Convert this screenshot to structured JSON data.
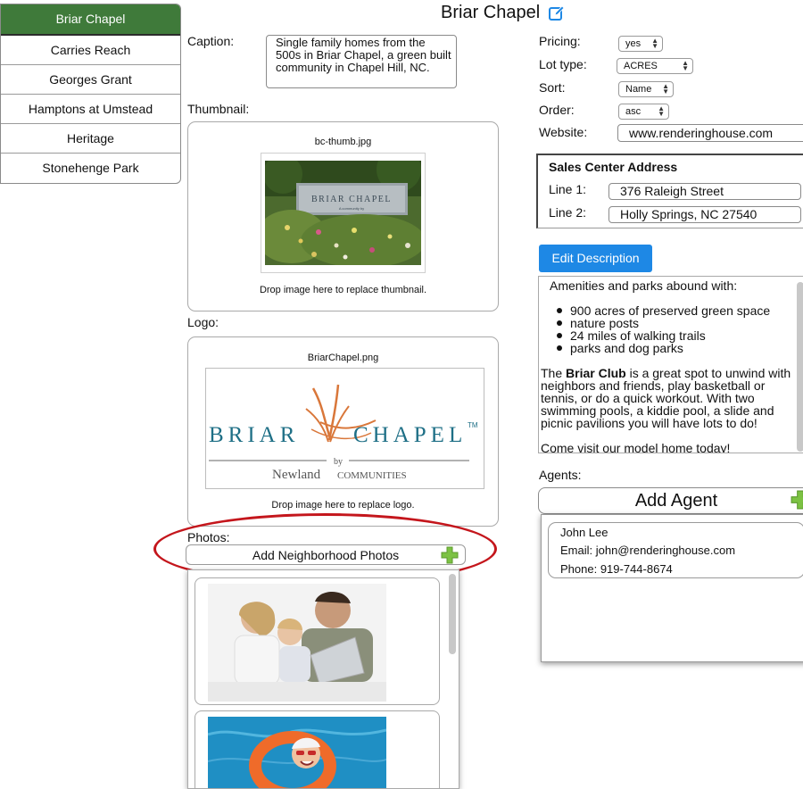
{
  "sidebar": {
    "items": [
      {
        "label": "Briar Chapel"
      },
      {
        "label": "Carries Reach"
      },
      {
        "label": "Georges Grant"
      },
      {
        "label": "Hamptons at Umstead"
      },
      {
        "label": "Heritage"
      },
      {
        "label": "Stonehenge Park"
      }
    ]
  },
  "header": {
    "title": "Briar Chapel",
    "edit_icon": "edit-pencil-icon"
  },
  "caption": {
    "label": "Caption:",
    "value": "Single family homes from the 500s in Briar Chapel, a green built community in Chapel Hill, NC."
  },
  "thumbnail": {
    "label": "Thumbnail:",
    "file_name": "bc-thumb.jpg",
    "drop_hint": "Drop image here to replace thumbnail.",
    "sign_text": "BRIAR CHAPEL",
    "sign_sub": "A community by"
  },
  "logo": {
    "label": "Logo:",
    "file_name": "BriarChapel.png",
    "drop_hint": "Drop image here to replace logo.",
    "brand_left": "BRIAR",
    "brand_right": "CHAPEL",
    "trademark": "TM",
    "by": "by",
    "newland": "Newland",
    "communities": "COMMUNITIES"
  },
  "photos": {
    "label": "Photos:",
    "add_button": "Add Neighborhood Photos"
  },
  "settings": {
    "pricing": {
      "label": "Pricing:",
      "value": "yes"
    },
    "lot_type": {
      "label": "Lot type:",
      "value": "ACRES"
    },
    "sort": {
      "label": "Sort:",
      "value": "Name"
    },
    "order": {
      "label": "Order:",
      "value": "asc"
    },
    "website": {
      "label": "Website:",
      "value": "www.renderinghouse.com"
    }
  },
  "sales_center": {
    "title": "Sales Center Address",
    "line1_label": "Line 1:",
    "line1": "376 Raleigh Street",
    "line2_label": "Line 2:",
    "line2": "Holly Springs, NC 27540"
  },
  "description": {
    "edit_button": "Edit Description",
    "intro": "Amenities and parks abound with:",
    "bullets": [
      "900 acres of preserved green space",
      "nature posts",
      "24 miles of walking trails",
      "parks and dog parks"
    ],
    "para_prefix": "The ",
    "para_bold": "Briar Club",
    "para_rest": " is a great spot to unwind with neighbors and friends, play basketball or tennis, or do a quick workout. With two swimming pools, a kiddie pool, a slide and picnic pavilions you will have lots to do!",
    "closing": "Come visit our model home today!"
  },
  "agents": {
    "label": "Agents:",
    "add_button": "Add Agent",
    "list": [
      {
        "name": "John Lee",
        "email": "Email: john@renderinghouse.com",
        "phone": "Phone: 919-744-8674"
      }
    ]
  },
  "colors": {
    "active_sidebar": "#3f7a3a",
    "primary_button": "#1e88e5",
    "highlight": "#c4161c",
    "plus_icon": "#7cc243",
    "edit_icon": "#1e88e5",
    "logo_teal": "#1e6f86",
    "logo_orange": "#d9773a"
  }
}
